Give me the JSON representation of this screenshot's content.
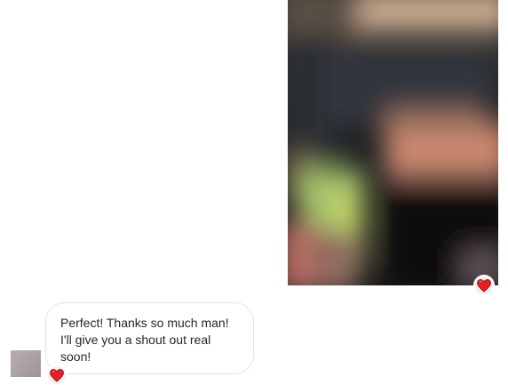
{
  "messages": {
    "outgoing_image": {
      "reaction": "heart-icon",
      "reaction_color": "#ed1c24"
    },
    "incoming_text": {
      "text": "Perfect! Thanks so much man! I'll give you a shout out real soon!",
      "reaction": "heart-icon",
      "reaction_color": "#ed1c24"
    }
  }
}
